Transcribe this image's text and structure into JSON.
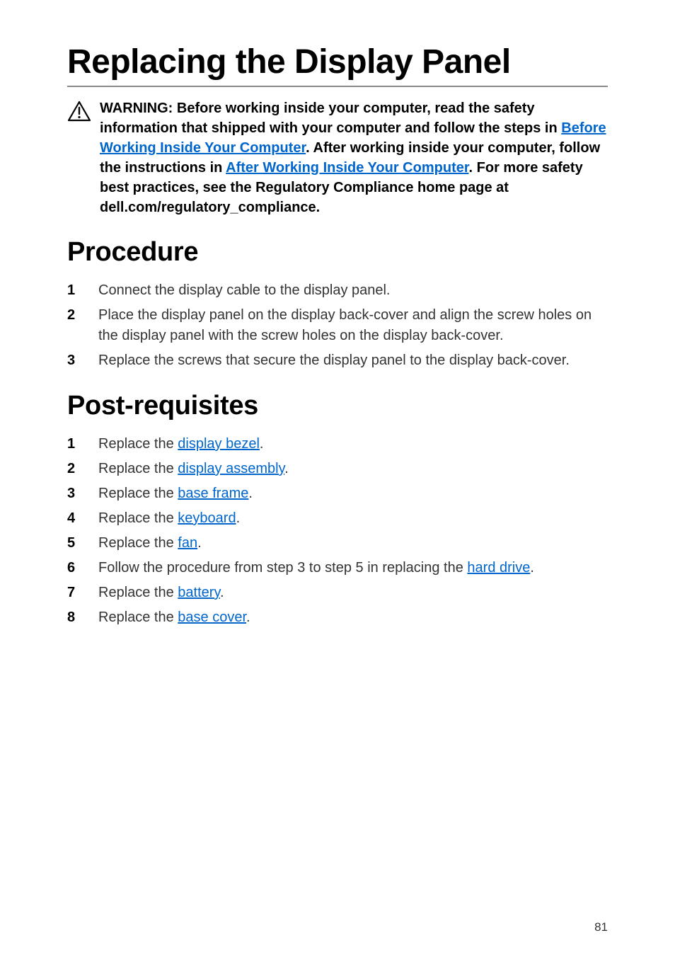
{
  "title": "Replacing the Display Panel",
  "warning": {
    "prefix": "WARNING: Before working inside your computer, read the safety information that shipped with your computer and follow the steps in ",
    "link1": "Before Working Inside Your Computer",
    "mid1": ". After working inside your computer, follow the instructions in ",
    "link2": "After Working Inside Your Computer",
    "suffix": ". For more safety best practices, see the Regulatory Compliance home page at dell.com/regulatory_compliance."
  },
  "procedure": {
    "heading": "Procedure",
    "items": [
      {
        "n": "1",
        "text": "Connect the display cable to the display panel."
      },
      {
        "n": "2",
        "text": "Place the display panel on the display back-cover and align the screw holes on the display panel with the screw holes on the display back-cover."
      },
      {
        "n": "3",
        "text": "Replace the screws that secure the display panel to the display back-cover."
      }
    ]
  },
  "postreq": {
    "heading": "Post-requisites",
    "items": [
      {
        "n": "1",
        "pre": "Replace the ",
        "link": "display bezel",
        "post": "."
      },
      {
        "n": "2",
        "pre": "Replace the ",
        "link": "display assembly",
        "post": "."
      },
      {
        "n": "3",
        "pre": "Replace the ",
        "link": "base frame",
        "post": "."
      },
      {
        "n": "4",
        "pre": "Replace the ",
        "link": "keyboard",
        "post": "."
      },
      {
        "n": "5",
        "pre": "Replace the ",
        "link": "fan",
        "post": "."
      },
      {
        "n": "6",
        "pre": "Follow the procedure from step 3 to step 5 in replacing the ",
        "link": "hard drive",
        "post": "."
      },
      {
        "n": "7",
        "pre": "Replace the ",
        "link": "battery",
        "post": "."
      },
      {
        "n": "8",
        "pre": "Replace the ",
        "link": "base cover",
        "post": "."
      }
    ]
  },
  "pageNumber": "81"
}
